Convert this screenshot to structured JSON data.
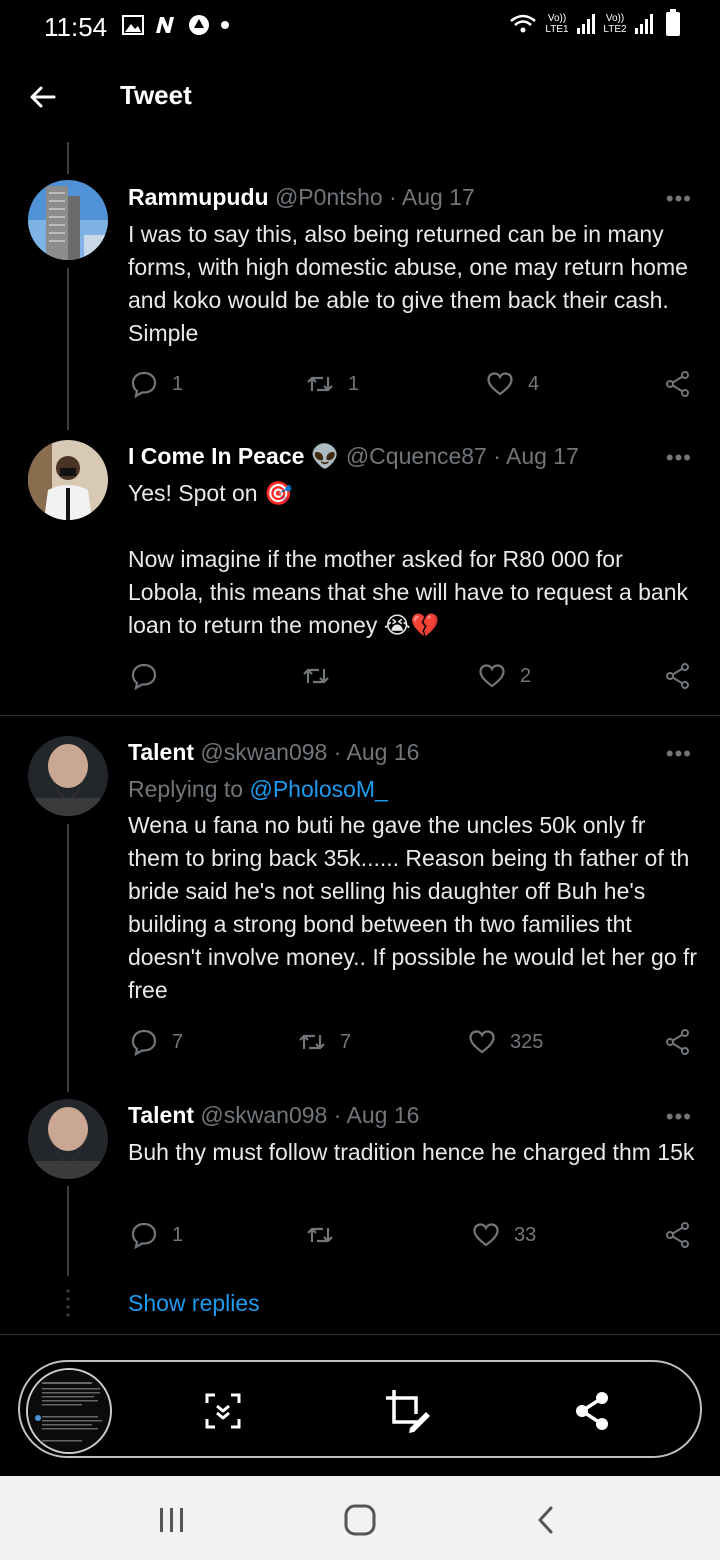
{
  "status_bar": {
    "time": "11:54",
    "sim1": "Vo)) LTE1",
    "sim2": "Vo)) LTE2"
  },
  "header": {
    "title": "Tweet"
  },
  "tweets": [
    {
      "name": "Rammupudu",
      "meta": "@P0ntsho · Aug 17",
      "body": "I was to say this, also being returned can be in many forms, with high domestic abuse, one may return home and koko would be able to give them back their cash. Simple",
      "replies": "1",
      "retweets": "1",
      "likes": "4"
    },
    {
      "name": "I Come In Peace 👽",
      "meta": "@Cquence87 · Aug 17",
      "body": "Yes! Spot on 🎯\n\nNow imagine if the mother asked for R80 000 for Lobola, this means that she will have to request a bank loan to return the money 😭💔",
      "replies": "",
      "retweets": "",
      "likes": "2"
    },
    {
      "name": "Talent",
      "meta": "@skwan098 · Aug 16",
      "reply_prefix": "Replying to ",
      "reply_handle": "@PholosoM_",
      "body": "Wena u fana no buti he gave the uncles 50k only fr them to bring back 35k...... Reason being th father of th bride said he's not selling his daughter off Buh he's building a strong bond between th two families tht doesn't involve money.. If possible he would let her go fr free",
      "replies": "7",
      "retweets": "7",
      "likes": "325"
    },
    {
      "name": "Talent",
      "meta": "@skwan098 · Aug 16",
      "body": "Buh thy must follow tradition hence he charged thm 15k",
      "replies": "1",
      "retweets": "",
      "likes": "33"
    }
  ],
  "show_replies": "Show replies",
  "more_glyph": "•••",
  "colors": {
    "accent": "#1d9bf0",
    "muted": "#71767b",
    "background": "#000000"
  },
  "icons": [
    "back-arrow-icon",
    "reply-icon",
    "retweet-icon",
    "like-icon",
    "share-icon",
    "scroll-capture-icon",
    "crop-edit-icon",
    "share-nodes-icon"
  ]
}
